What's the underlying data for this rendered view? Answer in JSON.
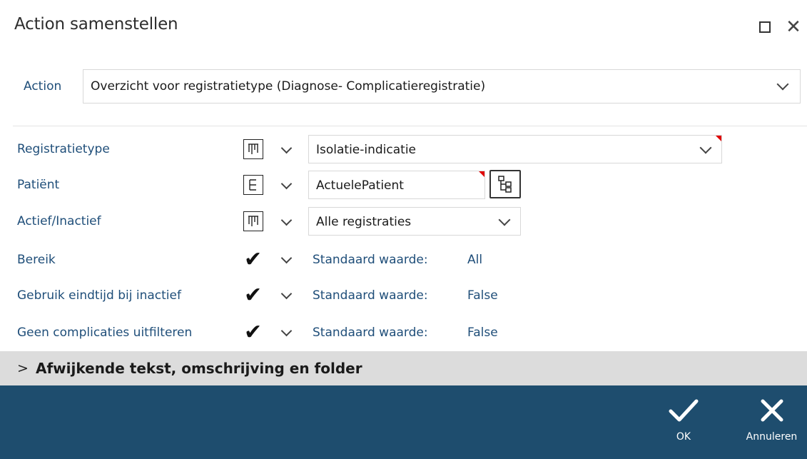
{
  "window": {
    "title": "Action samenstellen"
  },
  "action": {
    "label": "Action",
    "value": "Overzicht voor registratietype (Diagnose- Complicatieregistratie)"
  },
  "params": [
    {
      "label": "Registratietype",
      "type_icon": "list-icon",
      "value": "Isolatie-indicatie"
    },
    {
      "label": "Patiënt",
      "type_icon": "tree-icon",
      "value": "ActuelePatient"
    },
    {
      "label": "Actief/Inactief",
      "type_icon": "list-icon",
      "value": "Alle registraties"
    },
    {
      "label": "Bereik",
      "type_icon": "check-icon",
      "default_label": "Standaard waarde:",
      "default_value": "All"
    },
    {
      "label": "Gebruik eindtijd bij inactief",
      "type_icon": "check-icon",
      "default_label": "Standaard waarde:",
      "default_value": "False"
    },
    {
      "label": "Geen complicaties uitfilteren",
      "type_icon": "check-icon",
      "default_label": "Standaard waarde:",
      "default_value": "False"
    }
  ],
  "section": {
    "title": "Afwijkende tekst, omschrijving en folder"
  },
  "footer": {
    "ok_label": "OK",
    "cancel_label": "Annuleren"
  },
  "colors": {
    "label_blue": "#1f4e79",
    "footer_bg": "#1e4d6e",
    "section_bg": "#dcdcdc",
    "required_marker": "#e00000"
  }
}
